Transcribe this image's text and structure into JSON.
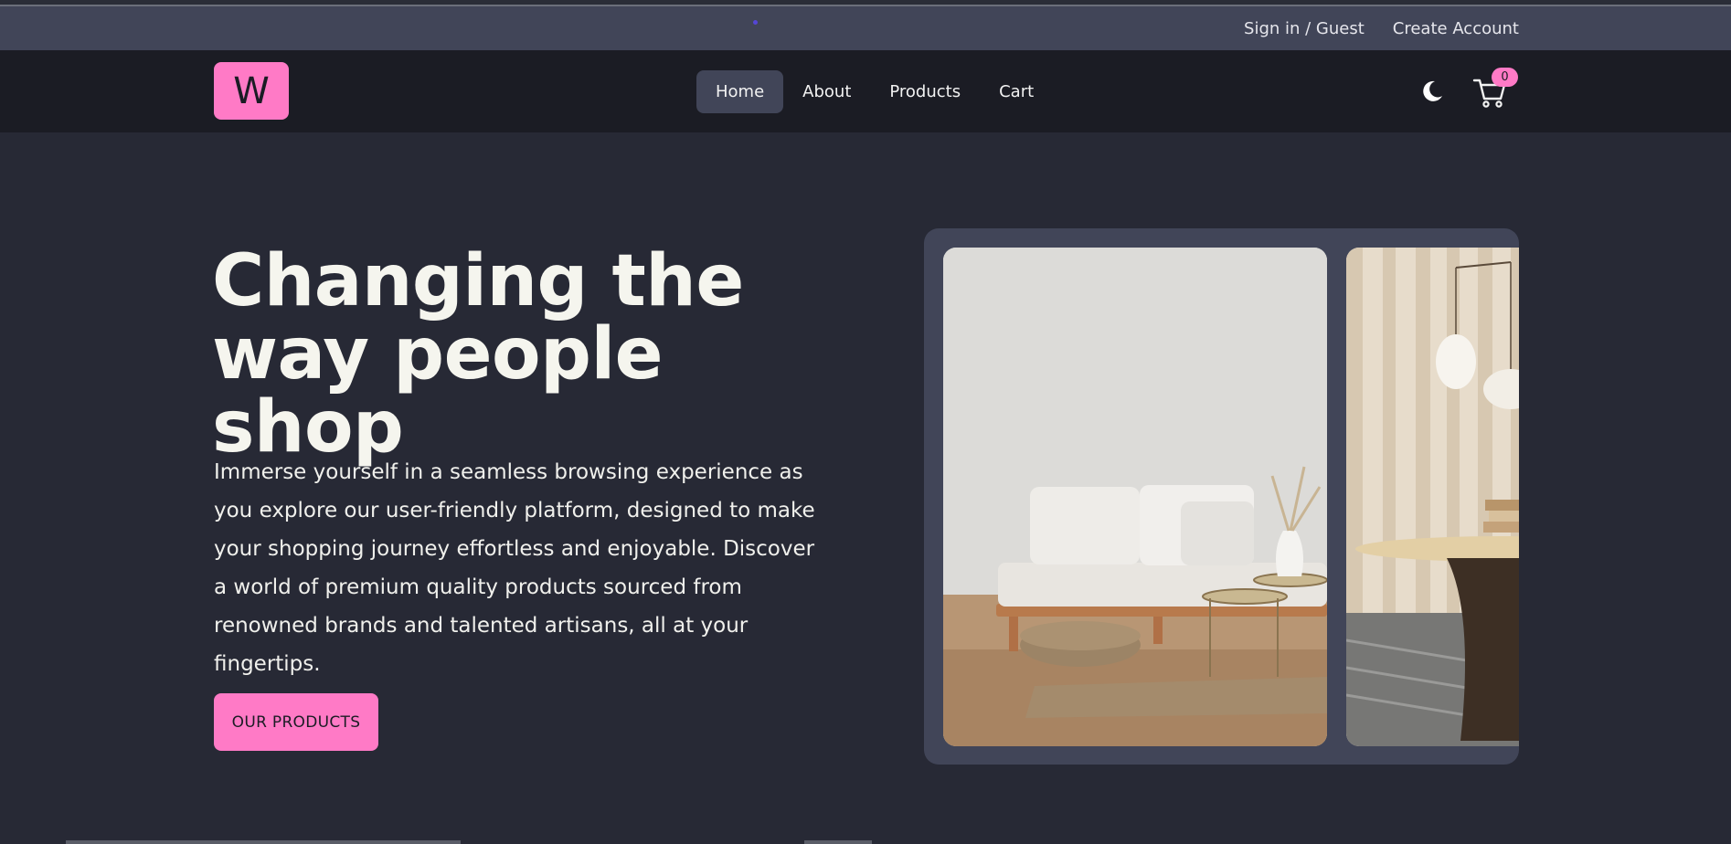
{
  "topbar": {
    "signin_label": "Sign in / Guest",
    "create_account_label": "Create Account"
  },
  "navbar": {
    "logo_letter": "W",
    "menu": [
      {
        "label": "Home",
        "active": true
      },
      {
        "label": "About",
        "active": false
      },
      {
        "label": "Products",
        "active": false
      },
      {
        "label": "Cart",
        "active": false
      }
    ],
    "theme_icon": "moon-icon",
    "cart_icon": "cart-icon",
    "cart_count": "0"
  },
  "hero": {
    "title_line1": "Changing the",
    "title_line2": "way people shop",
    "description": "Immerse yourself in a seamless browsing experience as you explore our user-friendly platform, designed to make your shopping journey effortless and enjoyable. Discover a world of premium quality products sourced from renowned brands and talented artisans, all at your fingertips.",
    "cta_label": "OUR PRODUCTS"
  },
  "carousel": {
    "slides": [
      "sofa-living-room-image",
      "round-table-pendant-lamps-image"
    ]
  },
  "colors": {
    "accent": "#ff7ac6",
    "background": "#272935",
    "navbar": "#1b1c24",
    "topbar": "#414558"
  }
}
